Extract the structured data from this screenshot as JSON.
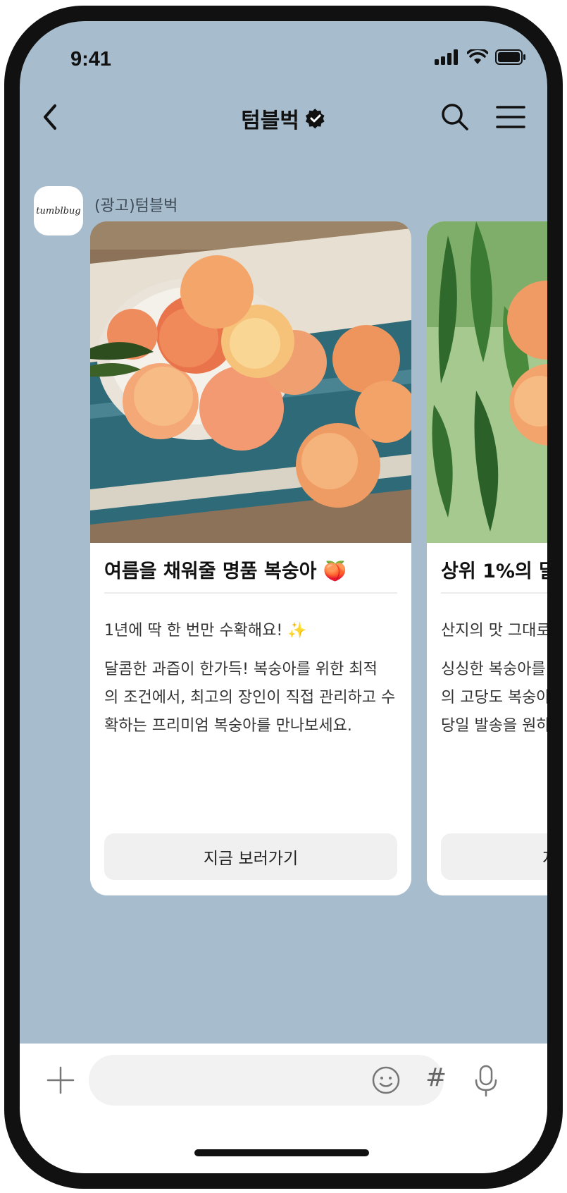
{
  "status_bar": {
    "time": "9:41",
    "icons": [
      "signal-icon",
      "wifi-icon",
      "battery-icon"
    ]
  },
  "header": {
    "title": "텀블벅",
    "icons": [
      "back-icon",
      "verified-badge-icon",
      "search-icon",
      "menu-icon"
    ]
  },
  "sender": {
    "name": "(광고)텀블벅",
    "avatar_text": "tumblbug"
  },
  "cards": [
    {
      "title": "여름을 채워줄 명품 복숭아 🍑",
      "subtitle": "1년에 딱 한 번만 수확해요! ✨",
      "description": "달콤한 과즙이 한가득! 복숭아를 위한 최적 의 조건에서, 최고의 장인이 직접 관리하고 수확하는 프리미엄 복숭아를 만나보세요.",
      "button_label": "지금 보러가기",
      "image": "peaches-in-bowl"
    },
    {
      "title": "상위 1%의 달",
      "subtitle": "산지의 맛 그대로",
      "description_lines": [
        "싱싱한 복숭아를",
        "의 고당도 복숭아",
        "당일 발송을 원하"
      ],
      "button_label": "지",
      "image": "peaches-on-tree"
    }
  ],
  "input_bar": {
    "icons": [
      "plus-icon",
      "emoji-icon",
      "hashtag-icon",
      "mic-icon"
    ],
    "hashtag_symbol": "#"
  },
  "colors": {
    "chat_background": "#a7bccd",
    "card_background": "#ffffff",
    "button_background": "#f0f0f0"
  }
}
